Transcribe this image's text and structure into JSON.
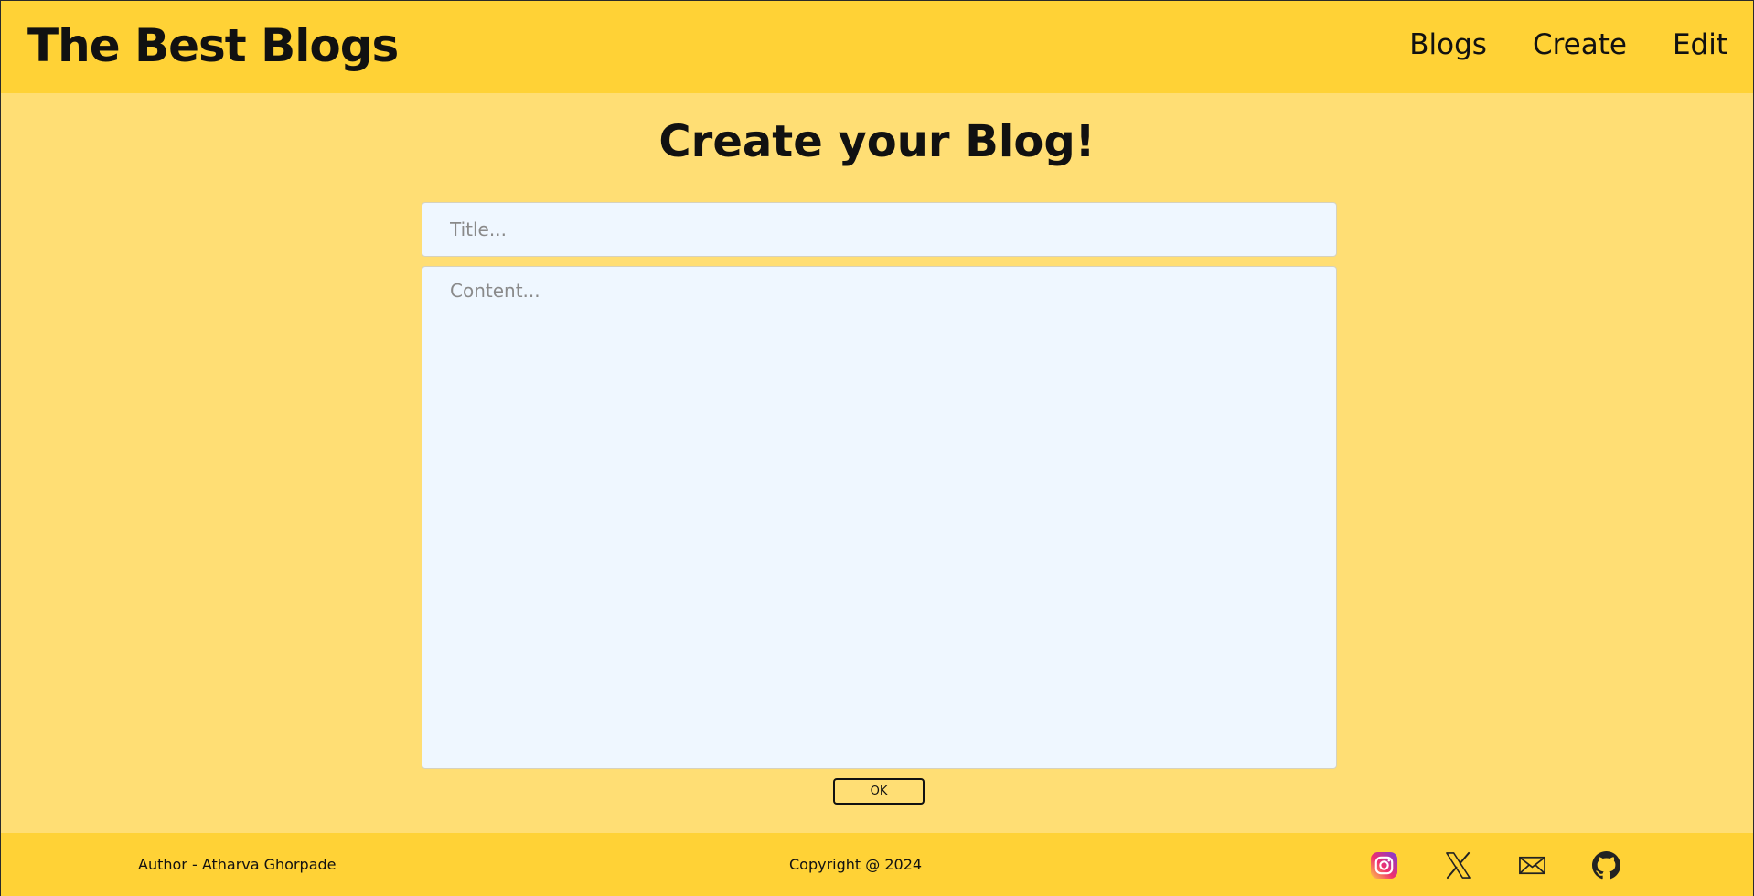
{
  "header": {
    "brand": "The Best Blogs",
    "nav": {
      "blogs": "Blogs",
      "create": "Create",
      "edit": "Edit"
    }
  },
  "main": {
    "heading": "Create your Blog!",
    "title_placeholder": "Title...",
    "content_placeholder": "Content...",
    "submit_label": "OK"
  },
  "footer": {
    "author": "Author - Atharva Ghorpade",
    "copyright": "Copyright @ 2024",
    "socials": [
      "instagram-icon",
      "x-icon",
      "mail-icon",
      "github-icon"
    ]
  }
}
